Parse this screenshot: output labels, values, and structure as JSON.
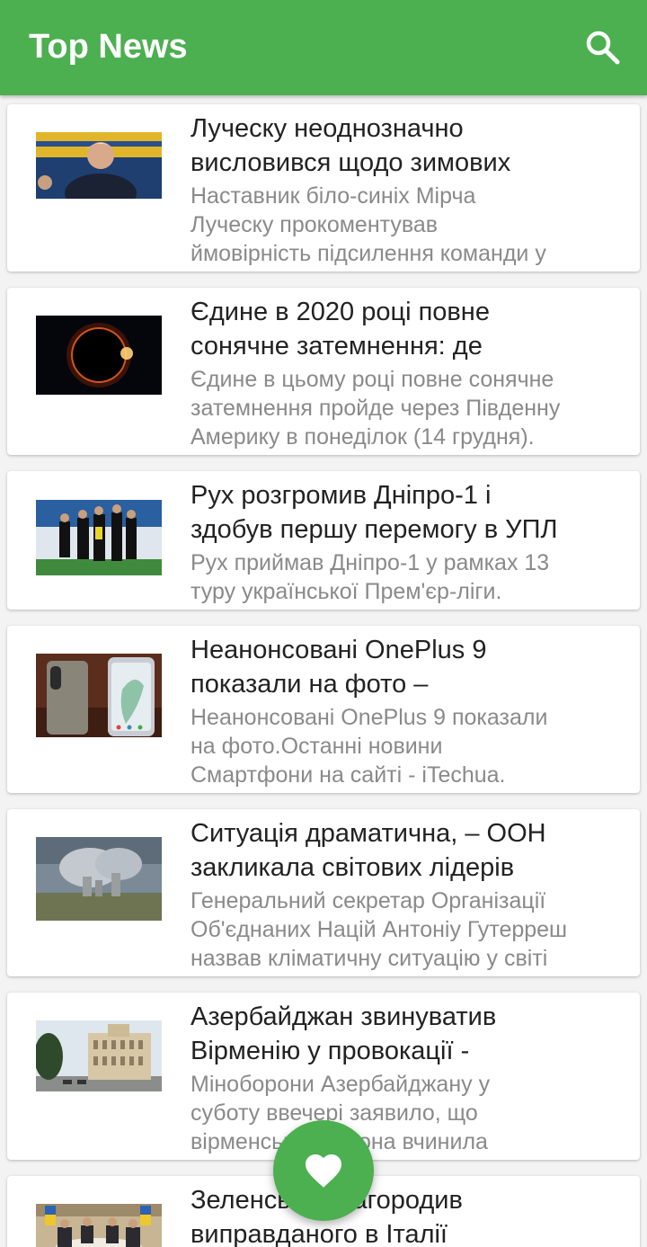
{
  "appbar": {
    "title": "Top News",
    "search_icon": "search-icon",
    "color": "#4caf50"
  },
  "news": [
    {
      "image": "coach-photo",
      "title1": "Луческу неоднозначно",
      "title2": "висловився щодо зимових",
      "desc": [
        "Наставник біло-синіх Мірча",
        "Луческу прокоментував",
        "ймовірність підсилення команди у"
      ]
    },
    {
      "image": "solar-eclipse-photo",
      "title1": "Єдине в 2020 році повне",
      "title2": "сонячне затемнення: де",
      "desc": [
        "Єдине в цьому році повне сонячне",
        "затемнення пройде через Південну",
        "Америку в понеділок (14 грудня)."
      ]
    },
    {
      "image": "football-team-photo",
      "title1": "Рух розгромив Дніпро-1 і",
      "title2": "здобув першу перемогу в УПЛ",
      "desc": [
        "Рух приймав Дніпро-1 у рамках 13",
        "туру української Прем'єр-ліги."
      ]
    },
    {
      "image": "oneplus-phones-photo",
      "title1": "Неанонсовані OnePlus 9",
      "title2": "показали на фото –",
      "desc": [
        "Неанонсовані OnePlus 9 показали",
        "на фото.Останні новини",
        "Смартфони на сайті - iTechua."
      ]
    },
    {
      "image": "power-plant-smoke-photo",
      "title1": "Ситуація драматична, – ООН",
      "title2": "закликала світових лідерів",
      "desc": [
        "Генеральний секретар Організації",
        "Об'єднаних Націй Антоніу Гутерреш",
        "назвав кліматичну ситуацію у світі"
      ]
    },
    {
      "image": "government-building-photo",
      "title1": "Азербайджан звинуватив",
      "title2": "Вірменію у провокації -",
      "desc": [
        "Міноборони Азербайджану у",
        "суботу ввечері заявило, що",
        "вірменська сторона вчинила"
      ]
    },
    {
      "image": "meeting-photo",
      "title1": "Зеленський нагородив",
      "title2": "виправданого в Італії",
      "desc": []
    }
  ],
  "fab": {
    "icon": "heart-icon",
    "color": "#4caf50"
  }
}
